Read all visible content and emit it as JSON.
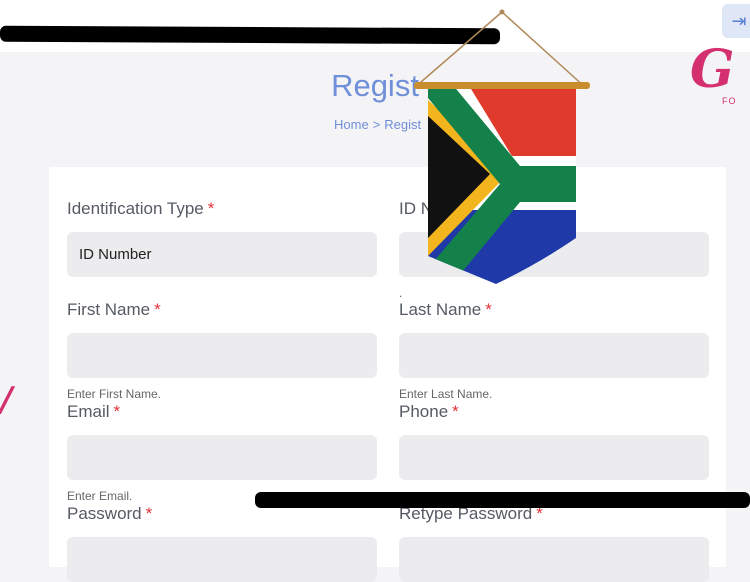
{
  "header": {
    "login_icon": "sign-in-arrow-icon",
    "logo_text": "G",
    "logo_sub": "FO"
  },
  "page": {
    "title": "Regist",
    "breadcrumb_home": "Home",
    "breadcrumb_sep": ">",
    "breadcrumb_current": "Regist"
  },
  "form": {
    "identification_type": {
      "label": "Identification Type",
      "value": "ID Number"
    },
    "id_number": {
      "label": "ID N",
      "help": "."
    },
    "first_name": {
      "label": "First Name",
      "help": "Enter First Name."
    },
    "last_name": {
      "label": "Last Name",
      "help": "Enter Last Name."
    },
    "email": {
      "label": "Email",
      "help": "Enter Email."
    },
    "phone": {
      "label": "Phone",
      "help": "."
    },
    "password": {
      "label": "Password"
    },
    "retype_password": {
      "label": "Retype Password"
    },
    "required_mark": "*"
  },
  "colors": {
    "accent": "#6f8fd8",
    "required": "#e0313a",
    "brand": "#d42f6f"
  }
}
